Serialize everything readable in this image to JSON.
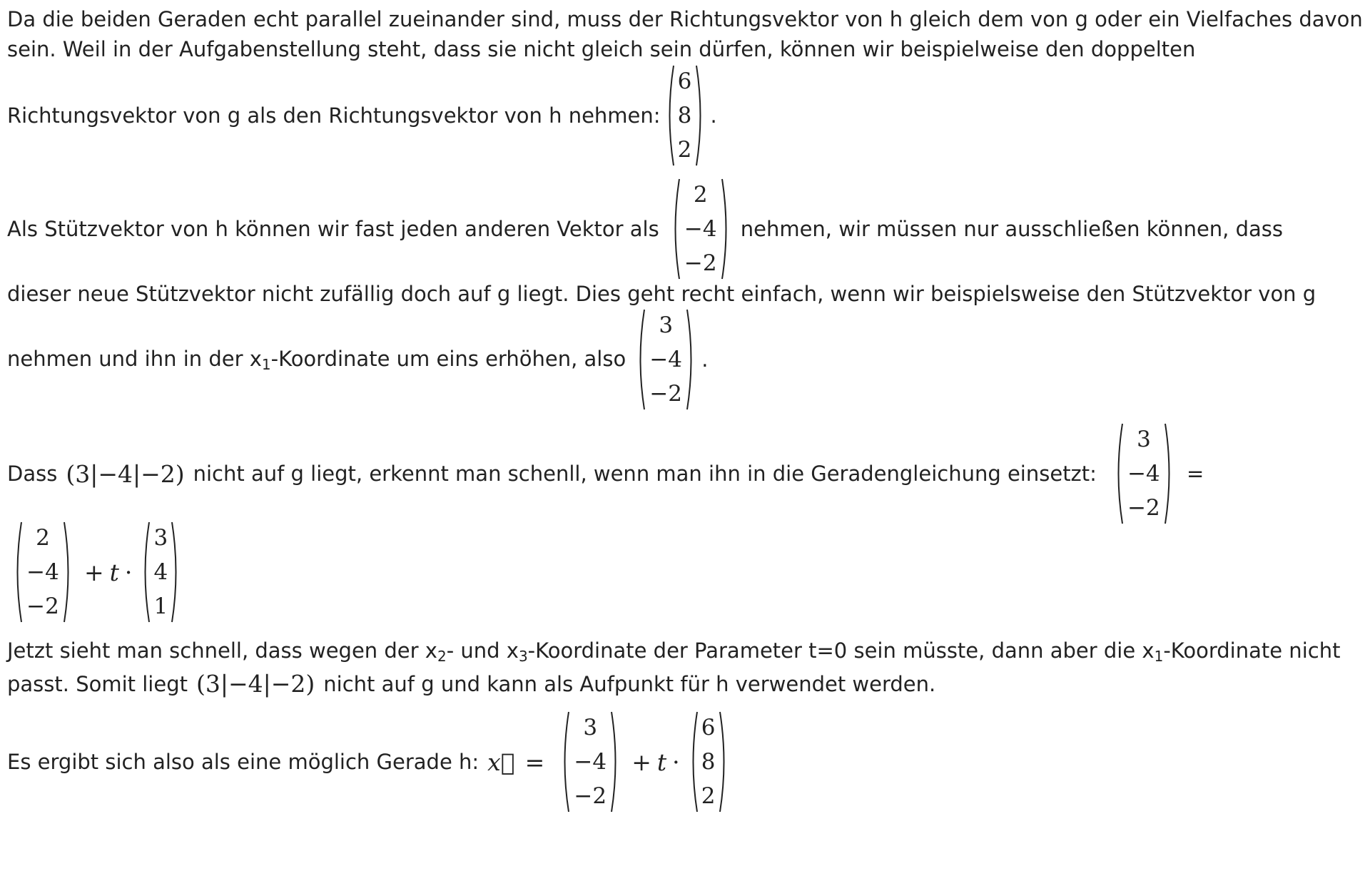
{
  "p1": {
    "line1": "Da die beiden Geraden echt parallel zueinander sind, muss der Richtungsvektor von h gleich dem von g oder ein Vielfaches davon",
    "line2": "sein. Weil in der Aufgabenstellung steht, dass sie nicht gleich sein dürfen, können wir beispielweise den doppelten",
    "line3": "Richtungsvektor von g als den Richtungsvektor von h nehmen:",
    "vec": [
      "6",
      "8",
      "2"
    ],
    "end": "."
  },
  "p2": {
    "before": "Als Stützvektor von h können wir fast jeden anderen Vektor als",
    "vec": [
      "2",
      "−4",
      "−2"
    ],
    "after": "nehmen, wir müssen nur ausschließen können, dass",
    "line2": "dieser neue Stützvektor nicht zufällig doch auf g liegt. Dies geht recht einfach, wenn wir beispielsweise den Stützvektor von g",
    "line3_a": "nehmen und ihn in der x",
    "line3_sub": "1",
    "line3_b": "-Koordinate um eins erhöhen, also",
    "vec2": [
      "3",
      "−4",
      "−2"
    ],
    "end": "."
  },
  "p3": {
    "a": "Dass",
    "point": "(3|−4|−2)",
    "b": "nicht auf g liegt, erkennt man schenll, wenn man ihn in die Geradengleichung einsetzt:",
    "vec": [
      "3",
      "−4",
      "−2"
    ],
    "eq": "=",
    "vec2": [
      "2",
      "−4",
      "−2"
    ],
    "plus": "+",
    "t": "t",
    "cdot": "·",
    "vec3": [
      "3",
      "4",
      "1"
    ]
  },
  "p4": {
    "a": "Jetzt sieht man schnell, dass wegen der x",
    "sub2": "2",
    "b": "- und x",
    "sub3": "3",
    "c": "-Koordinate der Parameter t=0 sein müsste, dann aber die x",
    "sub1": "1",
    "d": "-Koordinate nicht",
    "line2_a": "passt. Somit liegt",
    "point": "(3|−4|−2)",
    "line2_b": "nicht auf g und kann als Aufpunkt für h verwendet werden."
  },
  "p5": {
    "text": "Es ergibt sich also als eine möglich Gerade h:",
    "x": "x⃗",
    "eq": "=",
    "vec": [
      "3",
      "−4",
      "−2"
    ],
    "plus": "+",
    "t": "t",
    "cdot": "·",
    "vec2": [
      "6",
      "8",
      "2"
    ]
  }
}
